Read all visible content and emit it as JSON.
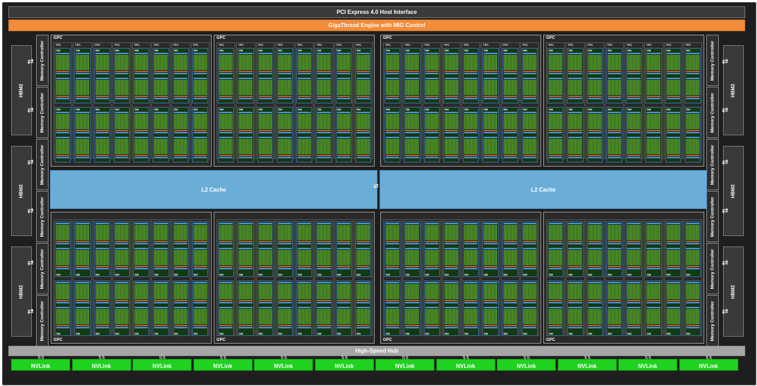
{
  "header": {
    "pcie": "PCI Express 4.0 Host Interface",
    "gigathread": "GigaThread Engine with MIG Control"
  },
  "hub": "High-Speed Hub",
  "l2_label": "L2 Cache",
  "gpc_label": "GPC",
  "tpc_label": "TPC",
  "sm_label": "SM",
  "hbm_label": "HBM2",
  "mc_label": "Memory Controller",
  "nvlink_label": "NVLink",
  "gpc_count": 8,
  "tpc_per_gpc": 8,
  "sm_per_tpc": 2,
  "hbm_stacks_per_side": 3,
  "memory_controllers_per_side": 6,
  "nvlink_count": 12,
  "colors": {
    "gigathread": "#f08c3a",
    "l2": "#6aaed8",
    "nvlink": "#1fd21f",
    "hub": "#a6a6a6",
    "sm_core": "#5fa830"
  }
}
